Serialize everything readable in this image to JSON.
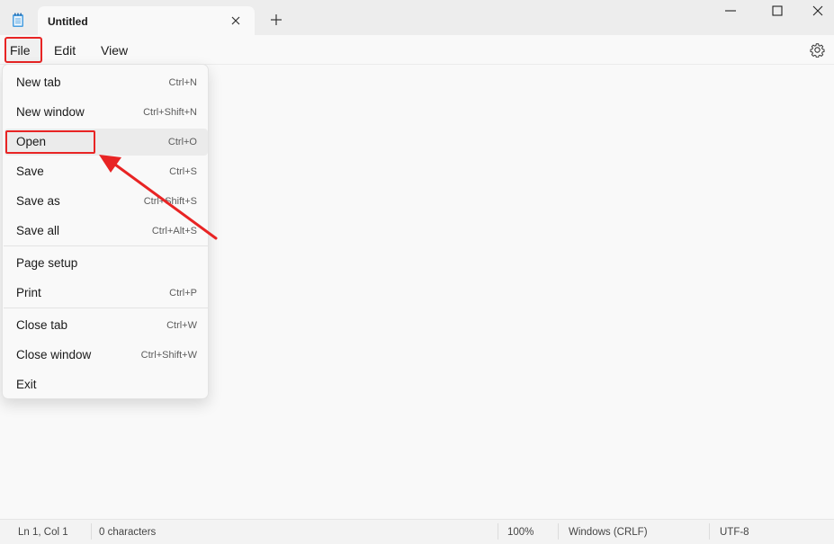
{
  "tab": {
    "title": "Untitled"
  },
  "menu": {
    "file": "File",
    "edit": "Edit",
    "view": "View"
  },
  "file_menu": {
    "groups": [
      [
        {
          "label": "New tab",
          "shortcut": "Ctrl+N"
        },
        {
          "label": "New window",
          "shortcut": "Ctrl+Shift+N"
        },
        {
          "label": "Open",
          "shortcut": "Ctrl+O",
          "highlighted": true
        },
        {
          "label": "Save",
          "shortcut": "Ctrl+S"
        },
        {
          "label": "Save as",
          "shortcut": "Ctrl+Shift+S"
        },
        {
          "label": "Save all",
          "shortcut": "Ctrl+Alt+S"
        }
      ],
      [
        {
          "label": "Page setup",
          "shortcut": ""
        },
        {
          "label": "Print",
          "shortcut": "Ctrl+P"
        }
      ],
      [
        {
          "label": "Close tab",
          "shortcut": "Ctrl+W"
        },
        {
          "label": "Close window",
          "shortcut": "Ctrl+Shift+W"
        },
        {
          "label": "Exit",
          "shortcut": ""
        }
      ]
    ]
  },
  "status": {
    "position": "Ln 1, Col 1",
    "characters": "0 characters",
    "zoom": "100%",
    "line_ending": "Windows (CRLF)",
    "encoding": "UTF-8"
  },
  "colors": {
    "annotation": "#e82424",
    "titlebar": "#ededed",
    "background": "#f9f9f9"
  },
  "icons": {
    "app": "notepad-icon",
    "tab_close": "close-icon",
    "new_tab": "plus-icon",
    "minimize": "minimize-icon",
    "maximize": "maximize-icon",
    "close": "close-icon",
    "settings": "gear-icon"
  }
}
